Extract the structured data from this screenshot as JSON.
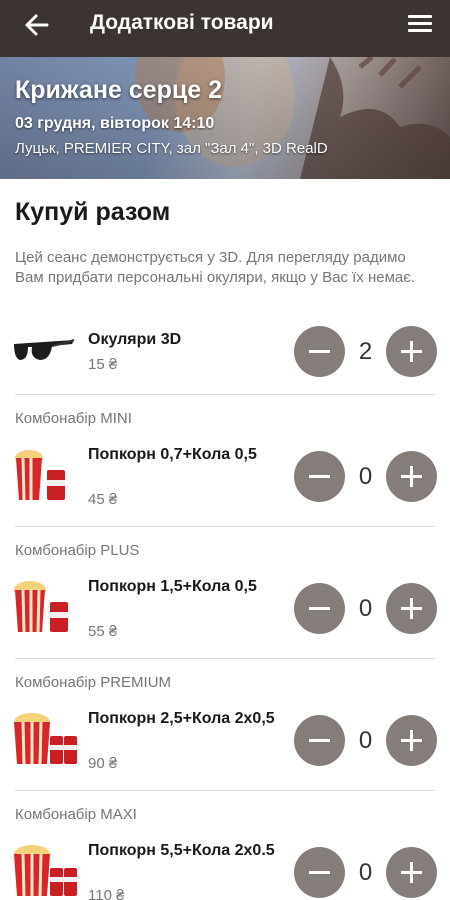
{
  "header": {
    "title": "Додаткові товари"
  },
  "session": {
    "movie": "Крижане серце 2",
    "datetime": "03 грудня, вівторок 14:10",
    "location": "Луцьк, PREMIER CITY, зал \"Зал 4\", 3D RealD"
  },
  "section": {
    "title": "Купуй разом",
    "notice": "Цей сеанс демонструється у 3D. Для перегляду радимо Вам придбати персональні окуляри, якщо у Вас їх немає."
  },
  "items": [
    {
      "group": "",
      "name": "Окуляри 3D",
      "price": "15 ₴",
      "qty": "2",
      "icon": "3d-glasses-icon"
    },
    {
      "group": "Комбонабір MINI",
      "name": "Попкорн 0,7+Кола 0,5",
      "price": "45 ₴",
      "qty": "0",
      "icon": "popcorn-cola-icon"
    },
    {
      "group": "Комбонабір PLUS",
      "name": "Попкорн 1,5+Кола 0,5",
      "price": "55 ₴",
      "qty": "0",
      "icon": "popcorn-cola-icon"
    },
    {
      "group": "Комбонабір PREMIUM",
      "name": "Попкорн 2,5+Кола 2х0,5",
      "price": "90 ₴",
      "qty": "0",
      "icon": "popcorn-two-colas-icon"
    },
    {
      "group": "Комбонабір MAXI",
      "name": "Попкорн 5,5+Кола 2х0.5",
      "price": "110 ₴",
      "qty": "0",
      "icon": "popcorn-two-colas-icon"
    }
  ],
  "colors": {
    "topbar": "#3c3431",
    "stepper": "#857d7a",
    "text_secondary": "#767676"
  }
}
